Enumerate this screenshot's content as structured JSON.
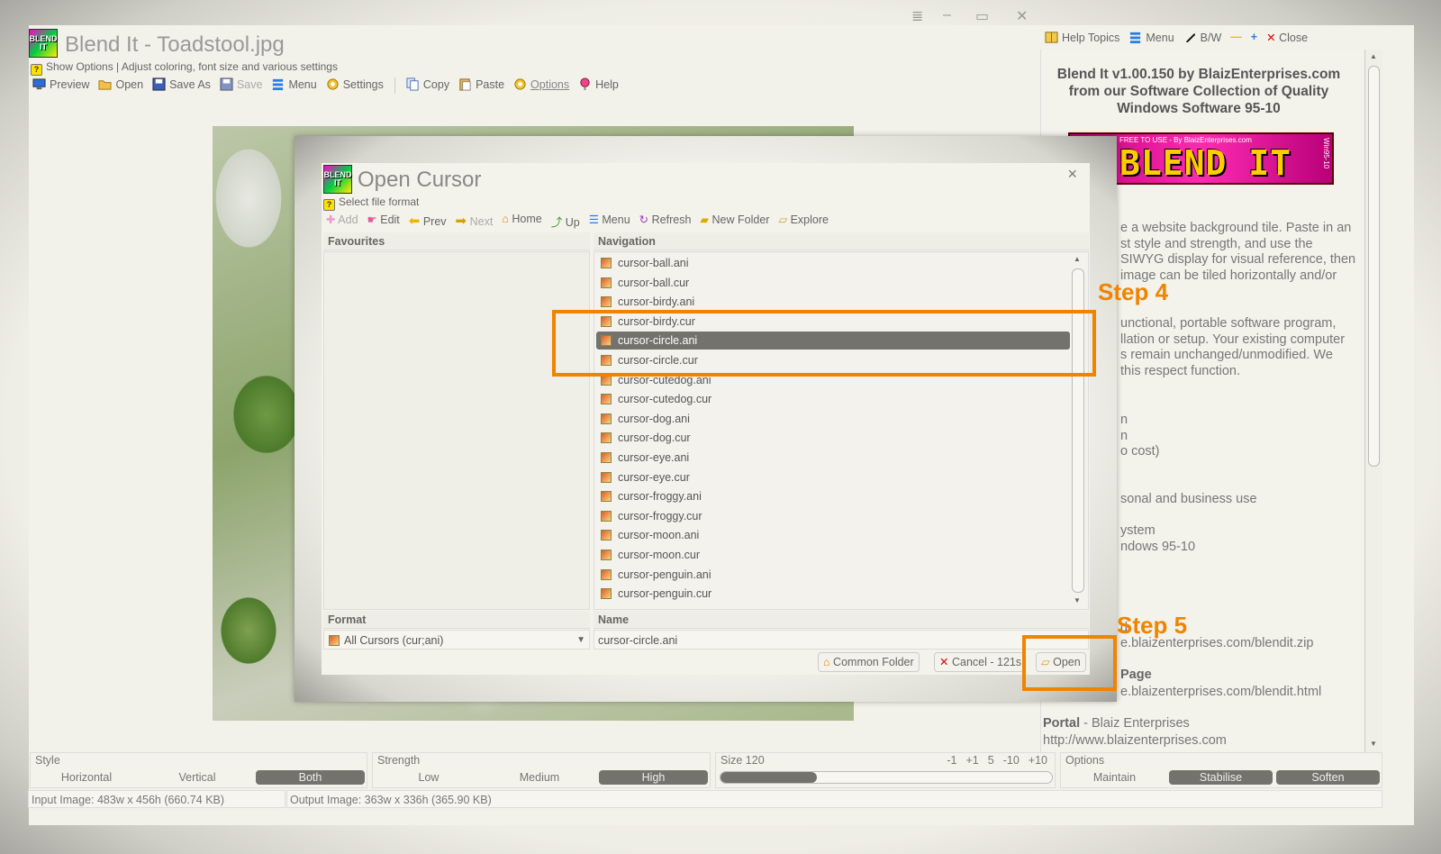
{
  "app": {
    "title": "Blend It - Toadstool.jpg",
    "logo_text": "BLEND IT",
    "hint": "Show Options | Adjust coloring, font size and various settings",
    "toolbar": [
      "Preview",
      "Open",
      "Save As",
      "Save",
      "Menu",
      "Settings",
      "Copy",
      "Paste",
      "Options",
      "Help"
    ]
  },
  "right_toolbar": [
    "Help Topics",
    "Menu",
    "B/W",
    "Close"
  ],
  "right_panel": {
    "heading": [
      "Blend It v1.00.150 by BlaizEnterprises.com",
      "from our Software Collection of Quality",
      "Windows Software 95-10"
    ],
    "banner_top": "FREE TO USE - By BlaizEnterprises.com",
    "banner_main": "BLEND IT",
    "banner_side": "Win95-10",
    "para1": [
      "e a website background tile.  Paste in an",
      "st style and strength, and use the",
      "SIWYG display for visual reference, then",
      "image can be tiled horizontally and/or"
    ],
    "para2": [
      "unctional, portable software program,",
      "llation or setup. Your existing computer",
      "s remain unchanged/unmodified.  We",
      " this respect function."
    ],
    "frag1": [
      "n",
      "n",
      "o cost)"
    ],
    "frag2": "sonal and business use",
    "frag3": [
      "ystem",
      "ndows 95-10"
    ],
    "download_label": "d",
    "download_url": "e.blaizenterprises.com/blendit.zip",
    "page_label": "Page",
    "page_url": "e.blaizenterprises.com/blendit.html",
    "portal_label": "Portal",
    "portal_name": " - Blaiz Enterprises",
    "portal_url": "http://www.blaizenterprises.com"
  },
  "dialog": {
    "title": "Open Cursor",
    "logo_text": "BLEND IT",
    "close": "×",
    "hint": "Select file format",
    "toolbar": [
      "Add",
      "Edit",
      "Prev",
      "Next",
      "Home",
      "Up",
      "Menu",
      "Refresh",
      "New Folder",
      "Explore"
    ],
    "favourites_header": "Favourites",
    "navigation_header": "Navigation",
    "files": [
      "cursor-ball.ani",
      "cursor-ball.cur",
      "cursor-birdy.ani",
      "cursor-birdy.cur",
      "cursor-circle.ani",
      "cursor-circle.cur",
      "cursor-cutedog.ani",
      "cursor-cutedog.cur",
      "cursor-dog.ani",
      "cursor-dog.cur",
      "cursor-eye.ani",
      "cursor-eye.cur",
      "cursor-froggy.ani",
      "cursor-froggy.cur",
      "cursor-moon.ani",
      "cursor-moon.cur",
      "cursor-penguin.ani",
      "cursor-penguin.cur"
    ],
    "selected_index": 4,
    "format_header": "Format",
    "format_value": "All Cursors (cur;ani)",
    "name_header": "Name",
    "name_value": "cursor-circle.ani",
    "common_folder": "Common Folder",
    "cancel": "Cancel - 121s",
    "open": "Open"
  },
  "steps": {
    "step4": "Step 4",
    "step5": "Step 5"
  },
  "controls": {
    "style_label": "Style",
    "style_options": [
      "Horizontal",
      "Vertical",
      "Both"
    ],
    "style_selected": 2,
    "strength_label": "Strength",
    "strength_options": [
      "Low",
      "Medium",
      "High"
    ],
    "strength_selected": 2,
    "size_label": "Size 120",
    "size_buttons": [
      "-1",
      "+1",
      "5",
      "-10",
      "+10"
    ],
    "size_fraction": 0.29,
    "options_label": "Options",
    "options_options": [
      "Maintain",
      "Stabilise",
      "Soften"
    ],
    "options_selected": [
      1,
      2
    ]
  },
  "status": {
    "input": "Input Image: 483w x 456h (660.74 KB)",
    "output": "Output Image: 363w x 336h (365.90 KB)"
  },
  "colors": {
    "accent": "#f08400",
    "selected": "#74726c"
  }
}
